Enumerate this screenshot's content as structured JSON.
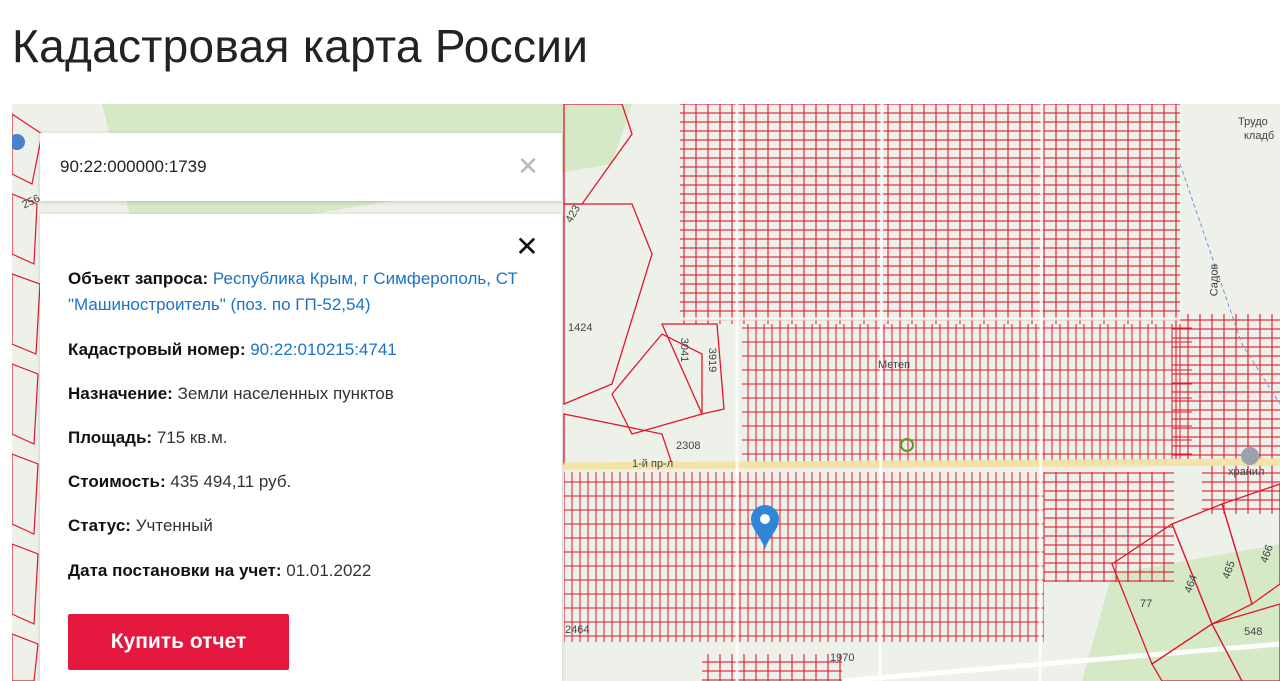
{
  "page": {
    "title": "Кадастровая карта России"
  },
  "search": {
    "value": "90:22:000000:1739",
    "clear_icon": "✕"
  },
  "info": {
    "close_icon": "✕",
    "rows": [
      {
        "label": "Объект запроса:",
        "value": "Республика Крым, г Симферополь, СТ \"Машиностроитель\" (поз. по ГП-52,54)"
      },
      {
        "label": "Кадастровый номер:",
        "value": "90:22:010215:4741"
      },
      {
        "label": "Назначение:",
        "value": "Земли населенных пунктов"
      },
      {
        "label": "Площадь:",
        "value": "715 кв.м."
      },
      {
        "label": "Стоимость:",
        "value": "435 494,11 руб."
      },
      {
        "label": "Статус:",
        "value": "Учтенный"
      },
      {
        "label": "Дата постановки на учет:",
        "value": "01.01.2022"
      }
    ],
    "buy_label": "Купить отчет"
  },
  "map": {
    "labels": {
      "l1424": "1424",
      "l3041": "3041",
      "l3919": "3919",
      "l2308": "2308",
      "l1ypr": "1-й пр-л",
      "l2464": "2464",
      "l1970": "1970",
      "l77": "77",
      "l464": "464",
      "l465": "465",
      "l466": "466",
      "l548": "548",
      "l423": "423",
      "l256": "256",
      "trud": "Трудо",
      "kladb": "кладб",
      "sadov": "Садов",
      "hrani": "хранил",
      "metg": "Метеп"
    },
    "colors": {
      "parcel": "#e0182d",
      "land": "#eef0ea",
      "green": "#d6e9c6",
      "road": "#f3e3a6",
      "pin": "#2f86d6"
    }
  }
}
